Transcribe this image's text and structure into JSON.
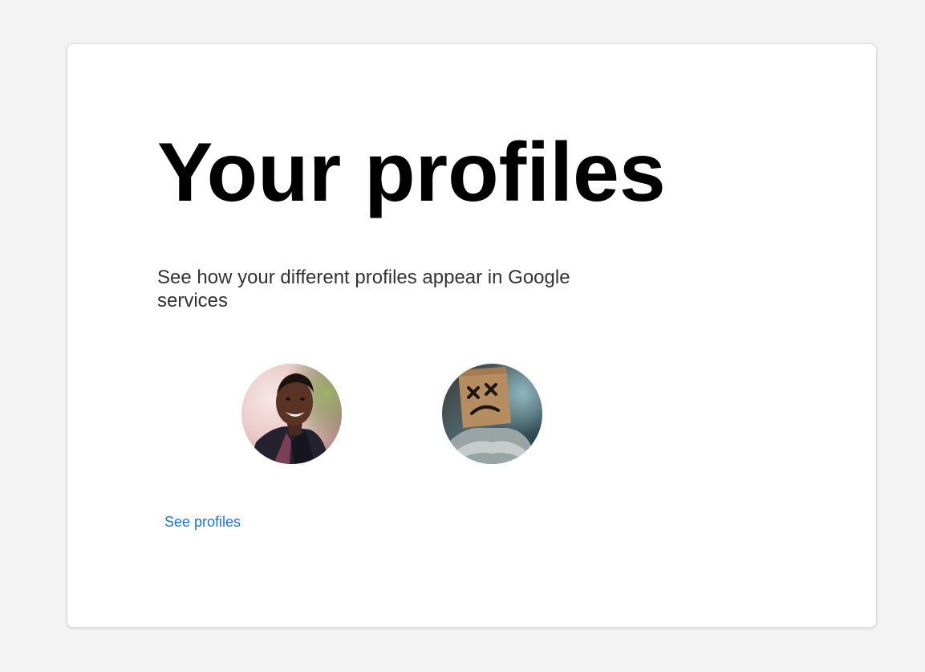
{
  "page": {
    "title": "Your profiles",
    "subtitle": "See how your different profiles appear in Google services"
  },
  "profiles": [
    {
      "avatar": "person-photo"
    },
    {
      "avatar": "paper-bag-mask-photo"
    }
  ],
  "actions": {
    "see_profiles_label": "See profiles"
  },
  "colors": {
    "background": "#f3f3f3",
    "card": "#ffffff",
    "link": "#1a73e8",
    "title": "#000000",
    "subtitle": "#333333"
  }
}
